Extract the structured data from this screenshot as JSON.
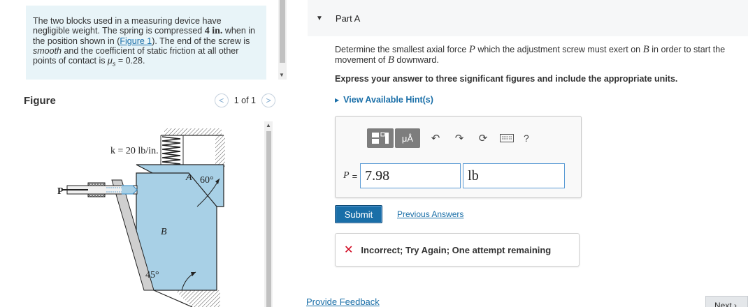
{
  "problem": {
    "text_1": "The two blocks used in a measuring device have negligible weight. The spring is compressed ",
    "spring_compression": "4 in.",
    "text_2": " when in the position shown in (",
    "figure_link": "Figure 1",
    "text_3": "). The end of the screw is ",
    "smooth": "smooth",
    "text_4": " and the coefficient of static friction at all other points of contact is ",
    "mu_symbol": "μ",
    "mu_sub": "s",
    "mu_value": " = 0.28."
  },
  "figure": {
    "title": "Figure",
    "pager_text": "1 of 1",
    "prev_icon": "chevron-left-icon",
    "next_icon": "chevron-right-icon",
    "k_label": "k = 20 lb/in.",
    "label_A": "A",
    "label_60": "60°",
    "label_P": "P",
    "label_B": "B",
    "label_45": "45°"
  },
  "part": {
    "title": "Part A",
    "question_1": "Determine the smallest axial force ",
    "var_P": "P",
    "question_2": " which the adjustment screw must exert on ",
    "var_B": "B",
    "question_3": " in order to start the movement of ",
    "var_B2": "B",
    "question_4": " downward.",
    "instructions": "Express your answer to three significant figures and include the appropriate units.",
    "hints_label": "View Available Hint(s)"
  },
  "answer": {
    "label_P": "P",
    "equals": "=",
    "value": "7.98",
    "unit": "lb",
    "toolbar_mu": "μÅ",
    "toolbar_help": "?"
  },
  "actions": {
    "submit_label": "Submit",
    "previous_answers": "Previous Answers",
    "feedback": "Incorrect; Try Again; One attempt remaining",
    "feedback_icon": "x-icon",
    "provide_feedback": "Provide Feedback",
    "next_label": "Next"
  },
  "colors": {
    "accent_blue": "#1a6fa8",
    "problem_bg": "#e8f4f8",
    "block_fill": "#a8d0e6",
    "error_red": "#d0021b"
  }
}
